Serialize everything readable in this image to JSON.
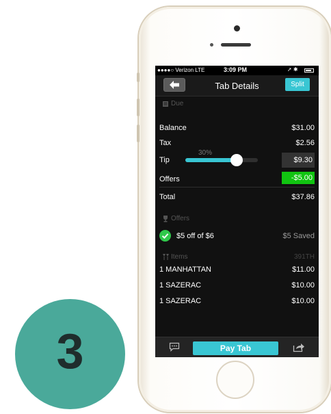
{
  "status": {
    "carrier": "●●●●○ Verizon  LTE",
    "time": "3:09 PM",
    "icons": "➚ ✱ "
  },
  "nav": {
    "title": "Tab Details",
    "split_label": "Split"
  },
  "due": {
    "section_label": "Due",
    "balance_label": "Balance",
    "balance_value": "$31.00",
    "tax_label": "Tax",
    "tax_value": "$2.56",
    "tip_label": "Tip",
    "tip_percent_label": "30%",
    "tip_fraction": 0.3,
    "tip_value": "$9.30",
    "offers_label": "Offers",
    "offers_value": "-$5.00",
    "total_label": "Total",
    "total_value": "$37.86"
  },
  "offers": {
    "section_label": "Offers",
    "items": [
      {
        "label": "$5 off of $6",
        "status": "$5 Saved"
      }
    ]
  },
  "items": {
    "section_label": "Items",
    "table_code": "391TH",
    "list": [
      {
        "name": "1 MANHATTAN",
        "price": "$11.00"
      },
      {
        "name": "1 SAZERAC",
        "price": "$10.00"
      },
      {
        "name": "1 SAZERAC",
        "price": "$10.00"
      }
    ]
  },
  "bottom": {
    "pay_label": "Pay Tab"
  },
  "step_number": "3",
  "colors": {
    "accent": "#39c6d3",
    "offer_green": "#11c411",
    "badge": "#4aa99a"
  },
  "icons": {
    "back": "left-arrow-icon",
    "chat": "chat-bubble-icon",
    "share": "share-icon",
    "receipt": "receipt-icon",
    "trophy": "trophy-icon",
    "cocktail": "cocktail-icon",
    "check": "check-circle-icon"
  }
}
